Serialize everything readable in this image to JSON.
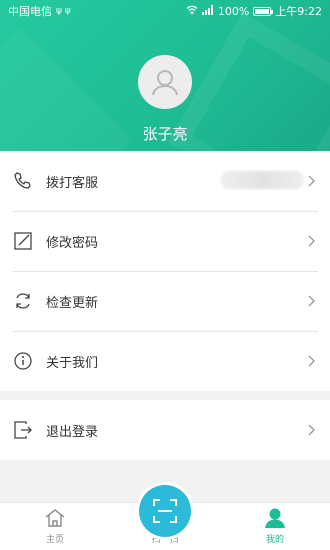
{
  "status_bar": {
    "carrier": "中国电信",
    "battery": "100%",
    "time": "上午9:22"
  },
  "profile": {
    "name": "张子亮"
  },
  "menu": {
    "items": [
      {
        "label": "拨打客服",
        "icon": "phone-icon"
      },
      {
        "label": "修改密码",
        "icon": "edit-icon"
      },
      {
        "label": "检查更新",
        "icon": "refresh-icon"
      },
      {
        "label": "关于我们",
        "icon": "info-icon"
      }
    ],
    "logout_label": "退出登录"
  },
  "tabbar": {
    "home": "主页",
    "scan": "扫一扫",
    "mine": "我的"
  },
  "colors": {
    "brand": "#1fbd95",
    "scan": "#2bbad8"
  }
}
